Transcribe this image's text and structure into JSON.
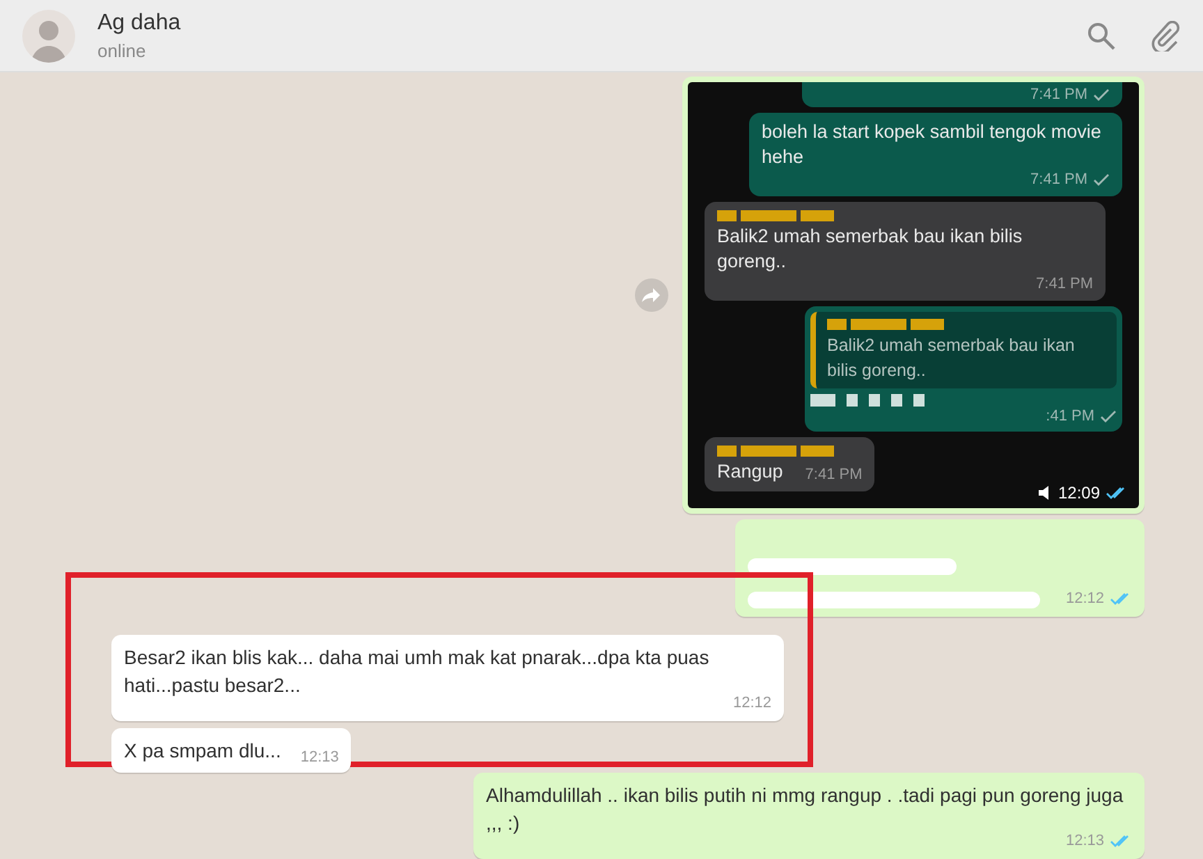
{
  "header": {
    "contact_name": "Ag daha",
    "status": "online"
  },
  "messages": [
    {
      "kind": "image",
      "outgoing": true,
      "highlighted": false,
      "time": "12:09",
      "read": true,
      "screenshot": [
        {
          "kind": "cut",
          "outgoing": true,
          "time": "7:41 PM",
          "read": false
        },
        {
          "kind": "text",
          "outgoing": true,
          "text": "boleh la start kopek sambil tengok movie hehe",
          "time": "7:41 PM",
          "read": false
        },
        {
          "kind": "text",
          "outgoing": false,
          "redacted_sender": true,
          "text": "Balik2 umah semerbak bau ikan bilis goreng..",
          "time": "7:41 PM"
        },
        {
          "kind": "reply",
          "outgoing": true,
          "redacted_sender": true,
          "quote": "Balik2 umah semerbak bau ikan bilis goreng..",
          "redacted_body": true,
          "time": ":41 PM",
          "read": false
        },
        {
          "kind": "short",
          "outgoing": false,
          "redacted_sender": true,
          "text": "Rangup",
          "time": "7:41 PM"
        }
      ]
    },
    {
      "kind": "redacted",
      "outgoing": true,
      "highlighted": false,
      "time": "12:12",
      "read": true
    },
    {
      "kind": "text",
      "outgoing": false,
      "highlighted": true,
      "text": "Besar2 ikan blis kak... daha mai umh mak kat pnarak...dpa kta puas hati...pastu besar2...",
      "time": "12:12"
    },
    {
      "kind": "short",
      "outgoing": false,
      "highlighted": true,
      "text": "X pa smpam dlu...",
      "time": "12:13"
    },
    {
      "kind": "text",
      "outgoing": true,
      "highlighted": false,
      "text": "Alhamdulillah .. ikan bilis putih ni mmg rangup . .tadi pagi pun goreng juga ,,, :)",
      "time": "12:13",
      "read": true
    }
  ]
}
